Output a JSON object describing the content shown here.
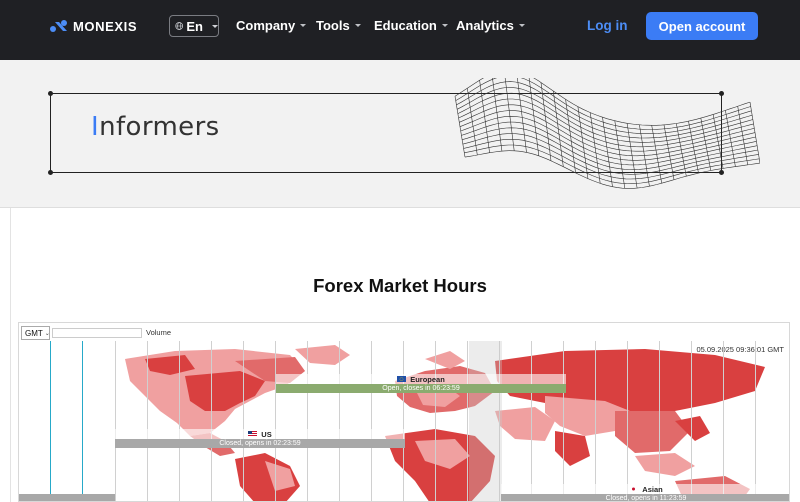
{
  "nav": {
    "logo": "MONEXIS",
    "language": "En",
    "menu": [
      {
        "label": "Company"
      },
      {
        "label": "Tools"
      },
      {
        "label": "Education"
      },
      {
        "label": "Analytics"
      }
    ],
    "login": "Log in",
    "open_account": "Open account"
  },
  "banner": {
    "title_first": "I",
    "title_rest": "nformers"
  },
  "main": {
    "title": "Forex Market Hours"
  },
  "widget": {
    "timezone": "GMT",
    "search_value": "",
    "volume_label": "Volume",
    "datetime": "05.09.2025 09:36:01 GMT",
    "sessions": [
      {
        "name": "European",
        "status": "Open, closes in 06:23:59",
        "state": "open"
      },
      {
        "name": "US",
        "status": "Closed, opens in 02:23:59",
        "state": "closed"
      },
      {
        "name": "Asian",
        "status": "Closed, opens in 11:23:59",
        "state": "closed"
      }
    ]
  },
  "colors": {
    "nav_bg": "#1f2024",
    "accent": "#3b7cf5",
    "open_bar": "#8bab6f",
    "closed_bar": "#a8a8a8",
    "map_dark": "#d94040",
    "map_light": "#f0a0a0"
  }
}
